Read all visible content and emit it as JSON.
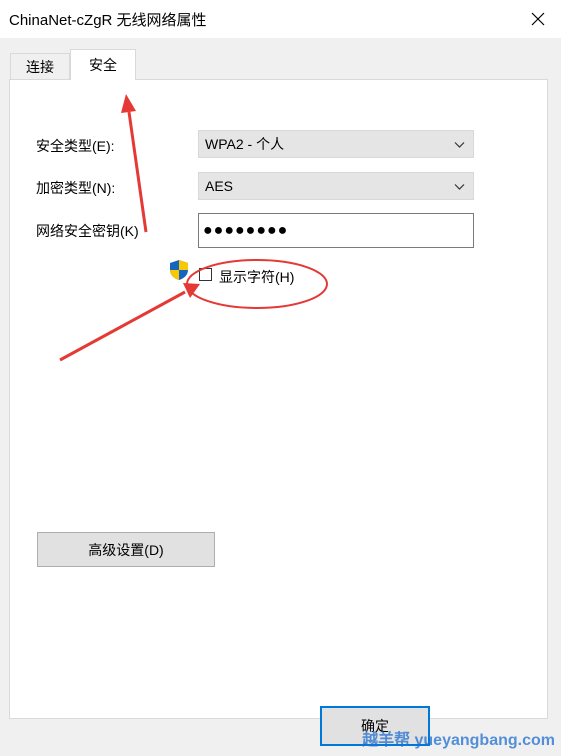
{
  "window": {
    "title": "ChinaNet-cZgR 无线网络属性",
    "close_glyph": "✕"
  },
  "tabs": [
    {
      "label": "连接",
      "active": false
    },
    {
      "label": "安全",
      "active": true
    }
  ],
  "form": {
    "security_type_label": "安全类型(E):",
    "security_type_value": "WPA2 - 个人",
    "encryption_type_label": "加密类型(N):",
    "encryption_type_value": "AES",
    "network_key_label": "网络安全密钥(K)",
    "network_key_value": "●●●●●●●●",
    "show_characters_label": "显示字符(H)",
    "show_characters_checked": false
  },
  "buttons": {
    "advanced_label": "高级设置(D)",
    "ok_label": "确定"
  },
  "annotation": {
    "color": "#e53935",
    "shield_colors": [
      "#1565c0",
      "#f9c802"
    ]
  },
  "watermark": {
    "text": "越羊帮 yueyangbang.com"
  }
}
